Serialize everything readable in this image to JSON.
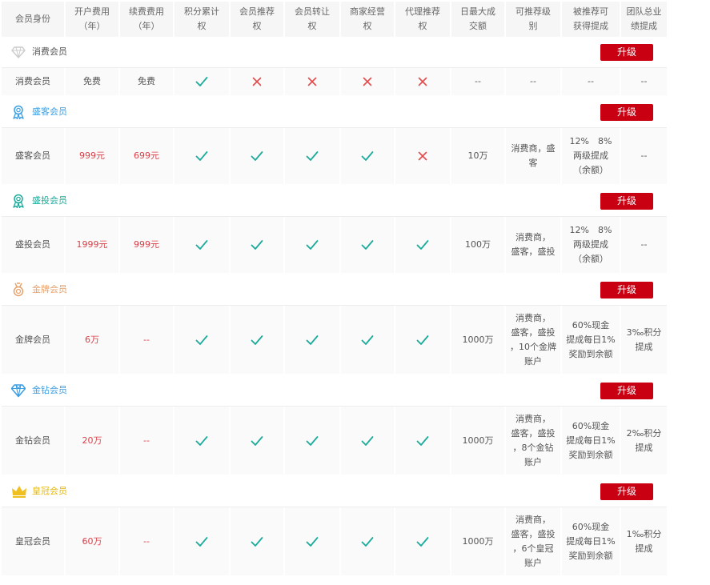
{
  "header": [
    "会员身份",
    "开户费用\n（年）",
    "续费费用\n（年）",
    "积分累计\n权",
    "会员推荐\n权",
    "会员转让\n权",
    "商家经营\n权",
    "代理推荐\n权",
    "日最大成\n交额",
    "可推荐级\n别",
    "被推荐可\n获得提成",
    "团队总业\n绩提成"
  ],
  "upgrade_label": "升级",
  "colors": {
    "check": "#1aab9b",
    "cross": "#e24b4b",
    "upgrade_bg": "#c90012",
    "fee_red": "#d9414a"
  },
  "tiers": [
    {
      "section_label": "消费会员",
      "label_color": "#555555",
      "icon": "diamond-outline-icon",
      "icon_color": "#cccccc",
      "name": "消费会员",
      "open_fee": "免费",
      "renew_fee": "免费",
      "fee_red": false,
      "rights": [
        true,
        false,
        false,
        false,
        false
      ],
      "daily_max": "--",
      "recommend_level": "--",
      "referral_commission": "--",
      "team_commission": "--"
    },
    {
      "section_label": "盛客会员",
      "label_color": "#3a9ee4",
      "icon": "award-ribbon-icon",
      "icon_color": "#3a9ee4",
      "name": "盛客会员",
      "open_fee": "999元",
      "renew_fee": "699元",
      "fee_red": true,
      "rights": [
        true,
        true,
        true,
        true,
        false
      ],
      "daily_max": "10万",
      "recommend_level": "消费商，盛\n客",
      "referral_commission": "12%　8%\n两级提成\n（余额）",
      "team_commission": "--"
    },
    {
      "section_label": "盛投会员",
      "label_color": "#1aab9b",
      "icon": "award-ribbon-icon",
      "icon_color": "#1aab9b",
      "name": "盛投会员",
      "open_fee": "1999元",
      "renew_fee": "999元",
      "fee_red": true,
      "rights": [
        true,
        true,
        true,
        true,
        true
      ],
      "daily_max": "100万",
      "recommend_level": "消费商，\n盛客，盛投",
      "referral_commission": "12%　8%\n两级提成\n（余额）",
      "team_commission": "--"
    },
    {
      "section_label": "金牌会员",
      "label_color": "#e8a06a",
      "icon": "gold-medal-icon",
      "icon_color": "#e8a06a",
      "name": "金牌会员",
      "open_fee": "6万",
      "renew_fee": "--",
      "fee_red": true,
      "rights": [
        true,
        true,
        true,
        true,
        true
      ],
      "daily_max": "1000万",
      "recommend_level": "消费商，\n盛客，盛投\n，10个金牌\n账户",
      "referral_commission": "60%现金\n提成每日1%\n奖励到余额",
      "team_commission": "3‰积分\n提成"
    },
    {
      "section_label": "金钻会员",
      "label_color": "#3a9ee4",
      "icon": "diamond-icon",
      "icon_color": "#3a9ee4",
      "name": "金钻会员",
      "open_fee": "20万",
      "renew_fee": "--",
      "fee_red": true,
      "rights": [
        true,
        true,
        true,
        true,
        true
      ],
      "daily_max": "1000万",
      "recommend_level": "消费商，\n盛客，盛投\n，8个金钻\n账户",
      "referral_commission": "60%现金\n提成每日1%\n奖励到余额",
      "team_commission": "2‰积分\n提成"
    },
    {
      "section_label": "皇冠会员",
      "label_color": "#e6b800",
      "icon": "crown-icon",
      "icon_color": "#f0c020",
      "name": "皇冠会员",
      "open_fee": "60万",
      "renew_fee": "--",
      "fee_red": true,
      "rights": [
        true,
        true,
        true,
        true,
        true
      ],
      "daily_max": "1000万",
      "recommend_level": "消费商，\n盛客，盛投\n，6个皇冠\n账户",
      "referral_commission": "60%现金\n提成每日1%\n奖励到余额",
      "team_commission": "1‰积分\n提成"
    }
  ]
}
